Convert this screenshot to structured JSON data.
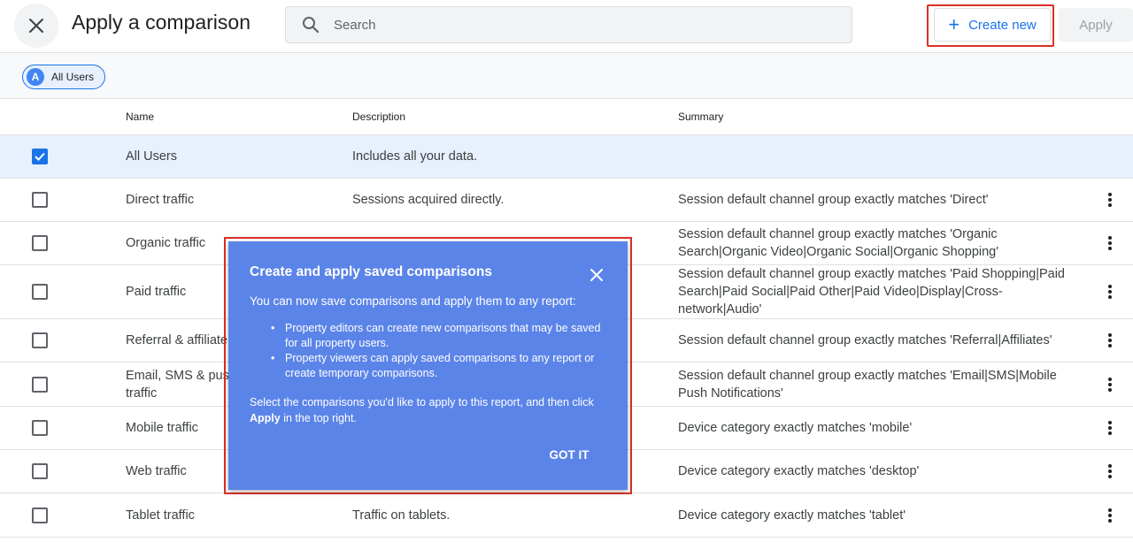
{
  "header": {
    "title": "Apply a comparison",
    "search_placeholder": "Search",
    "create_new_label": "Create new",
    "apply_label": "Apply"
  },
  "chips": {
    "active_chip_letter": "A",
    "active_chip_label": "All Users"
  },
  "table": {
    "columns": {
      "name": "Name",
      "description": "Description",
      "summary": "Summary"
    },
    "rows": [
      {
        "name": "All Users",
        "description": "Includes all your data.",
        "summary": "",
        "checked": true
      },
      {
        "name": "Direct traffic",
        "description": "Sessions acquired directly.",
        "summary": "Session default channel group exactly matches 'Direct'",
        "checked": false
      },
      {
        "name": "Organic traffic",
        "description": "",
        "summary": "Session default channel group exactly matches 'Organic Search|Organic Video|Organic Social|Organic Shopping'",
        "checked": false
      },
      {
        "name": "Paid traffic",
        "description": "",
        "summary": "Session default channel group exactly matches 'Paid Shopping|Paid Search|Paid Social|Paid Other|Paid Video|Display|Cross-network|Audio'",
        "checked": false
      },
      {
        "name": "Referral & affiliate",
        "description": "",
        "summary": "Session default channel group exactly matches 'Referral|Affiliates'",
        "checked": false
      },
      {
        "name": "Email, SMS & push traffic",
        "description": "",
        "summary": "Session default channel group exactly matches 'Email|SMS|Mobile Push Notifications'",
        "checked": false
      },
      {
        "name": "Mobile traffic",
        "description": "",
        "summary": "Device category exactly matches 'mobile'",
        "checked": false
      },
      {
        "name": "Web traffic",
        "description": "",
        "summary": "Device category exactly matches 'desktop'",
        "checked": false
      },
      {
        "name": "Tablet traffic",
        "description": "Traffic on tablets.",
        "summary": "Device category exactly matches 'tablet'",
        "checked": false
      }
    ]
  },
  "popup": {
    "title": "Create and apply saved comparisons",
    "intro": "You can now save comparisons and apply them to any report:",
    "bullets": [
      "Property editors can create new comparisons that may be saved for all property users.",
      "Property viewers can apply saved comparisons to any report or create temporary comparisons."
    ],
    "outro_before": "Select the comparisons you'd like to apply to this report, and then click ",
    "outro_bold": "Apply",
    "outro_after": " in the top right.",
    "button_label": "GOT IT"
  },
  "colors": {
    "accent": "#1a73e8",
    "popup_bg": "#5b84e8",
    "highlight": "#d93025",
    "selected_row": "#e8f0fe"
  },
  "icons": {
    "close": "close-icon",
    "search": "search-icon",
    "add": "plus-icon",
    "more": "more-vert-icon",
    "check": "check-icon"
  }
}
